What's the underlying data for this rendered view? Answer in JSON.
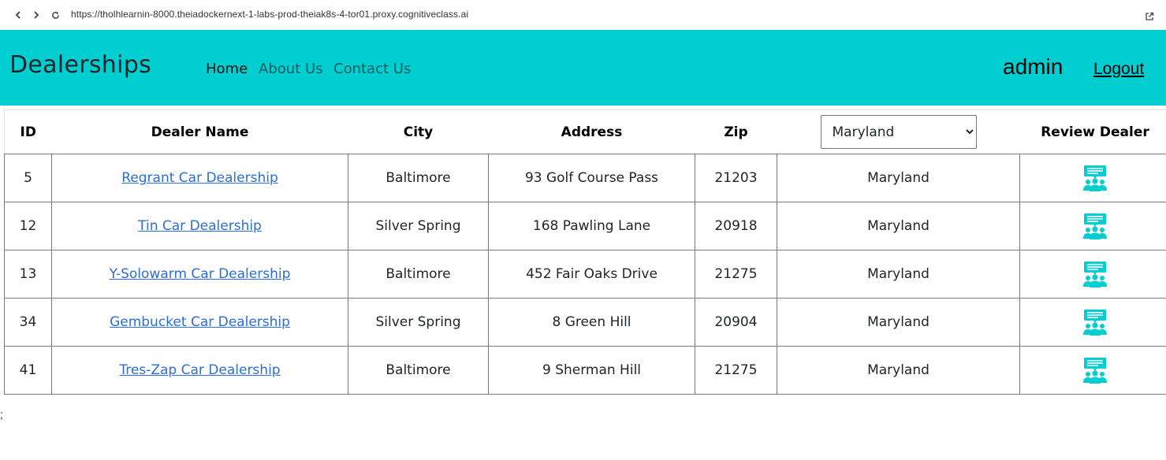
{
  "browser": {
    "url": "https://tholhlearnin-8000.theiadockernext-1-labs-prod-theiak8s-4-tor01.proxy.cognitiveclass.ai"
  },
  "navbar": {
    "brand": "Dealerships",
    "links": [
      {
        "label": "Home",
        "active": true
      },
      {
        "label": "About Us",
        "active": false
      },
      {
        "label": "Contact Us",
        "active": false
      }
    ],
    "username": "admin",
    "logout_label": "Logout",
    "background_color": "#00ced1"
  },
  "table": {
    "headers": {
      "id": "ID",
      "dealer_name": "Dealer Name",
      "city": "City",
      "address": "Address",
      "zip": "Zip",
      "review": "Review Dealer"
    },
    "state_filter": {
      "selected": "Maryland"
    },
    "rows": [
      {
        "id": "5",
        "name": "Regrant Car Dealership",
        "city": "Baltimore",
        "address": "93 Golf Course Pass",
        "zip": "21203",
        "state": "Maryland"
      },
      {
        "id": "12",
        "name": "Tin Car Dealership",
        "city": "Silver Spring",
        "address": "168 Pawling Lane",
        "zip": "20918",
        "state": "Maryland"
      },
      {
        "id": "13",
        "name": "Y-Solowarm Car Dealership",
        "city": "Baltimore",
        "address": "452 Fair Oaks Drive",
        "zip": "21275",
        "state": "Maryland"
      },
      {
        "id": "34",
        "name": "Gembucket Car Dealership",
        "city": "Silver Spring",
        "address": "8 Green Hill",
        "zip": "20904",
        "state": "Maryland"
      },
      {
        "id": "41",
        "name": "Tres-Zap Car Dealership",
        "city": "Baltimore",
        "address": "9 Sherman Hill",
        "zip": "21275",
        "state": "Maryland"
      }
    ],
    "review_icon": "review-people-icon",
    "icon_color": "#00ced1",
    "link_color": "#2b6ed9"
  },
  "footer_text": ";"
}
